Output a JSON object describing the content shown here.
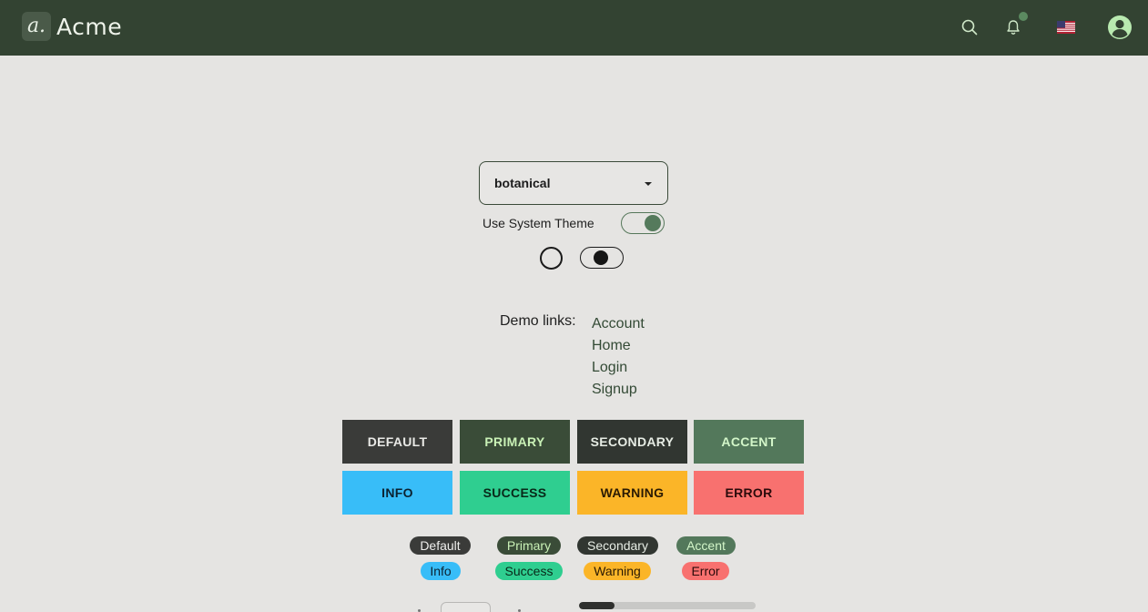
{
  "header": {
    "brand_logo": "a.",
    "brand_name": "Acme",
    "icons": [
      "search-icon",
      "bell-icon",
      "us-flag-icon",
      "user-avatar-icon"
    ],
    "notification_indicator": true,
    "colors": {
      "bar": "#334332",
      "dot": "#5b8a60"
    }
  },
  "theme": {
    "selected": "botanical",
    "system_theme_label": "Use System Theme",
    "system_theme_on": true
  },
  "demo": {
    "label": "Demo links:",
    "links": [
      "Account",
      "Home",
      "Login",
      "Signup"
    ]
  },
  "buttons": {
    "default": "DEFAULT",
    "primary": "PRIMARY",
    "secondary": "SECONDARY",
    "accent": "ACCENT",
    "info": "INFO",
    "success": "SUCCESS",
    "warning": "WARNING",
    "error": "ERROR"
  },
  "badges": {
    "default": "Default",
    "primary": "Primary",
    "secondary": "Secondary",
    "accent": "Accent",
    "info": "Info",
    "success": "Success",
    "warning": "Warning",
    "error": "Error"
  },
  "progress": {
    "value": 0.2
  },
  "colors": {
    "default": "#3a3b39",
    "primary": "#3a4c38",
    "secondary": "#313631",
    "accent": "#53785b",
    "info": "#38bdf8",
    "success": "#2fce90",
    "warning": "#fbb528",
    "error": "#f8716f"
  }
}
